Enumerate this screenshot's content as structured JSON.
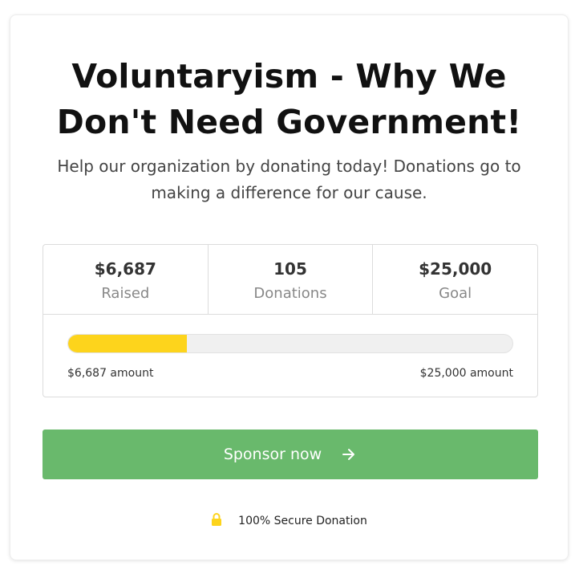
{
  "campaign": {
    "title": "Voluntaryism - Why We Don't Need Government!",
    "subtitle": "Help our organization by donating today! Donations go to making a difference for our cause."
  },
  "stats": [
    {
      "value": "$6,687",
      "label": "Raised"
    },
    {
      "value": "105",
      "label": "Donations"
    },
    {
      "value": "$25,000",
      "label": "Goal"
    }
  ],
  "progress": {
    "fraction": 0.2675,
    "left_label": "$6,687 amount",
    "right_label": "$25,000 amount",
    "fill_color": "#fdd41c"
  },
  "sponsor_button": {
    "label": "Sponsor now",
    "icon": "arrow-right-icon",
    "color": "#69b96c"
  },
  "secure_note": {
    "text": "100% Secure Donation",
    "icon": "lock-icon",
    "icon_color": "#fdd41c"
  }
}
